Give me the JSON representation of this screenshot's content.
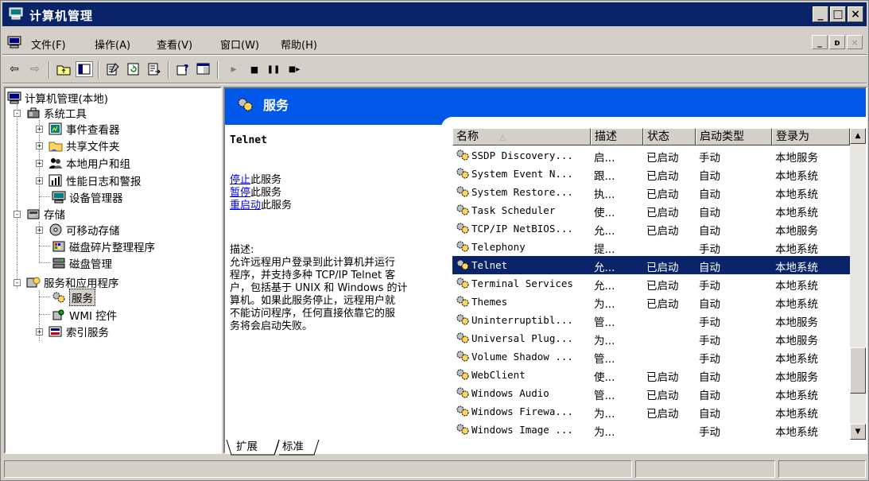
{
  "window": {
    "title": "计算机管理",
    "min": "_",
    "max": "□",
    "close": "×"
  },
  "menu": {
    "items": [
      "文件(F)",
      "操作(A)",
      "查看(V)",
      "窗口(W)",
      "帮助(H)"
    ],
    "mdi_min": "_",
    "mdi_restore": "ᴅ",
    "mdi_close": "×"
  },
  "toolbar": {
    "back": "⇦",
    "forward": "⇨",
    "play": "▸",
    "stop": "■",
    "pause": "❚❚",
    "restart": "■▸"
  },
  "tree": {
    "root": "计算机管理(本地)",
    "system_tools": "系统工具",
    "event_viewer": "事件查看器",
    "shared_folders": "共享文件夹",
    "local_users": "本地用户和组",
    "perf_logs": "性能日志和警报",
    "device_manager": "设备管理器",
    "storage": "存储",
    "removable": "可移动存储",
    "defrag": "磁盘碎片整理程序",
    "disk_mgmt": "磁盘管理",
    "services_apps": "服务和应用程序",
    "services": "服务",
    "wmi": "WMI 控件",
    "indexing": "索引服务"
  },
  "panel": {
    "header": "服务",
    "service_name": "Telnet",
    "stop_link": "停止",
    "stop_rest": "此服务",
    "pause_link": "暂停",
    "pause_rest": "此服务",
    "restart_link": "重启动",
    "restart_rest": "此服务",
    "desc_label": "描述:",
    "desc_lines": [
      "允许远程用户登录到此计算机并运行",
      "程序，并支持多种 TCP/IP Telnet 客",
      "户，包括基于 UNIX 和 Windows 的计",
      "算机。如果此服务停止，远程用户就",
      "不能访问程序，任何直接依靠它的服",
      "务将会启动失败。"
    ]
  },
  "columns": [
    "名称",
    "描述",
    "状态",
    "启动类型",
    "登录为"
  ],
  "sort_indicator": "△",
  "services": [
    {
      "name": "SSDP Discovery...",
      "desc": "启...",
      "status": "已启动",
      "startup": "手动",
      "logon": "本地服务"
    },
    {
      "name": "System Event N...",
      "desc": "跟...",
      "status": "已启动",
      "startup": "自动",
      "logon": "本地系统"
    },
    {
      "name": "System Restore...",
      "desc": "执...",
      "status": "已启动",
      "startup": "自动",
      "logon": "本地系统"
    },
    {
      "name": "Task Scheduler",
      "desc": "使...",
      "status": "已启动",
      "startup": "自动",
      "logon": "本地系统"
    },
    {
      "name": "TCP/IP NetBIOS...",
      "desc": "允...",
      "status": "已启动",
      "startup": "自动",
      "logon": "本地服务"
    },
    {
      "name": "Telephony",
      "desc": "提...",
      "status": "",
      "startup": "手动",
      "logon": "本地系统"
    },
    {
      "name": "Telnet",
      "desc": "允...",
      "status": "已启动",
      "startup": "自动",
      "logon": "本地系统",
      "selected": true
    },
    {
      "name": "Terminal Services",
      "desc": "允...",
      "status": "已启动",
      "startup": "手动",
      "logon": "本地系统"
    },
    {
      "name": "Themes",
      "desc": "为...",
      "status": "已启动",
      "startup": "自动",
      "logon": "本地系统"
    },
    {
      "name": "Uninterruptibl...",
      "desc": "管...",
      "status": "",
      "startup": "手动",
      "logon": "本地服务"
    },
    {
      "name": "Universal Plug...",
      "desc": "为...",
      "status": "",
      "startup": "手动",
      "logon": "本地服务"
    },
    {
      "name": "Volume Shadow ...",
      "desc": "管...",
      "status": "",
      "startup": "手动",
      "logon": "本地系统"
    },
    {
      "name": "WebClient",
      "desc": "使...",
      "status": "已启动",
      "startup": "自动",
      "logon": "本地服务"
    },
    {
      "name": "Windows Audio",
      "desc": "管...",
      "status": "已启动",
      "startup": "自动",
      "logon": "本地系统"
    },
    {
      "name": "Windows Firewa...",
      "desc": "为...",
      "status": "已启动",
      "startup": "自动",
      "logon": "本地系统"
    },
    {
      "name": "Windows Image ...",
      "desc": "为...",
      "status": "",
      "startup": "手动",
      "logon": "本地系统"
    }
  ],
  "tabs": [
    "扩展",
    "标准"
  ],
  "colors": {
    "title_bg": "#0a246a",
    "header_bg": "#0058e8",
    "selection_bg": "#0a246a",
    "link": "#0000ff"
  }
}
